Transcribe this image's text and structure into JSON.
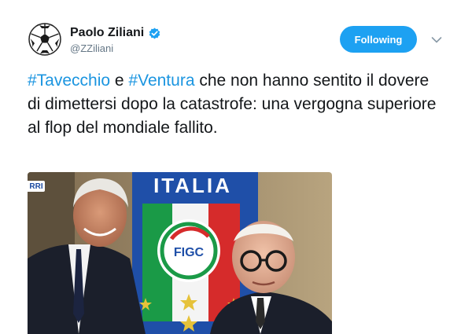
{
  "author": {
    "name": "Paolo Ziliani",
    "handle": "@ZZiliani",
    "avatar_icon": "soccer-ball-icon",
    "verified_icon": "verified-badge-icon"
  },
  "follow_button": {
    "label": "Following"
  },
  "menu": {
    "caret_icon": "chevron-down-icon"
  },
  "tweet": {
    "hashtag_1": "#Tavecchio",
    "connector": " e ",
    "hashtag_2": "#Ventura",
    "body": " che non hanno sentito il dovere di dimettersi dopo la catastrofe: una vergogna superiore al flop del mondiale fallito."
  },
  "photo": {
    "banner_text": "ITALIA",
    "badge_text": "FIGC",
    "corner_text": "RRI"
  },
  "colors": {
    "accent": "#1da1f2",
    "hashtag": "#1b95e0",
    "banner_blue": "#1f4fa8"
  }
}
